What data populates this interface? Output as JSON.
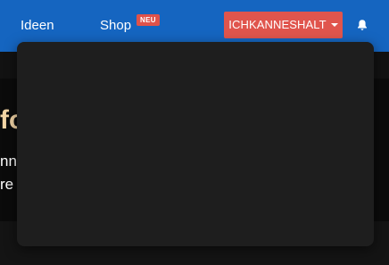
{
  "nav": {
    "ideen_label": "Ideen",
    "shop_label": "Shop",
    "shop_badge": "NEU",
    "user_button_label": "ICHKANNESHALT",
    "bell_icon": "bell-icon"
  },
  "hero": {
    "title_fragment": "fo",
    "text_fragment_1": "nnt",
    "text_fragment_2": "re"
  },
  "colors": {
    "navbar": "#1565c0",
    "user_button": "#e0554d",
    "badge": "#e0524a",
    "dropdown": "#1e1e1e",
    "hero_title": "#f4d6a6"
  }
}
